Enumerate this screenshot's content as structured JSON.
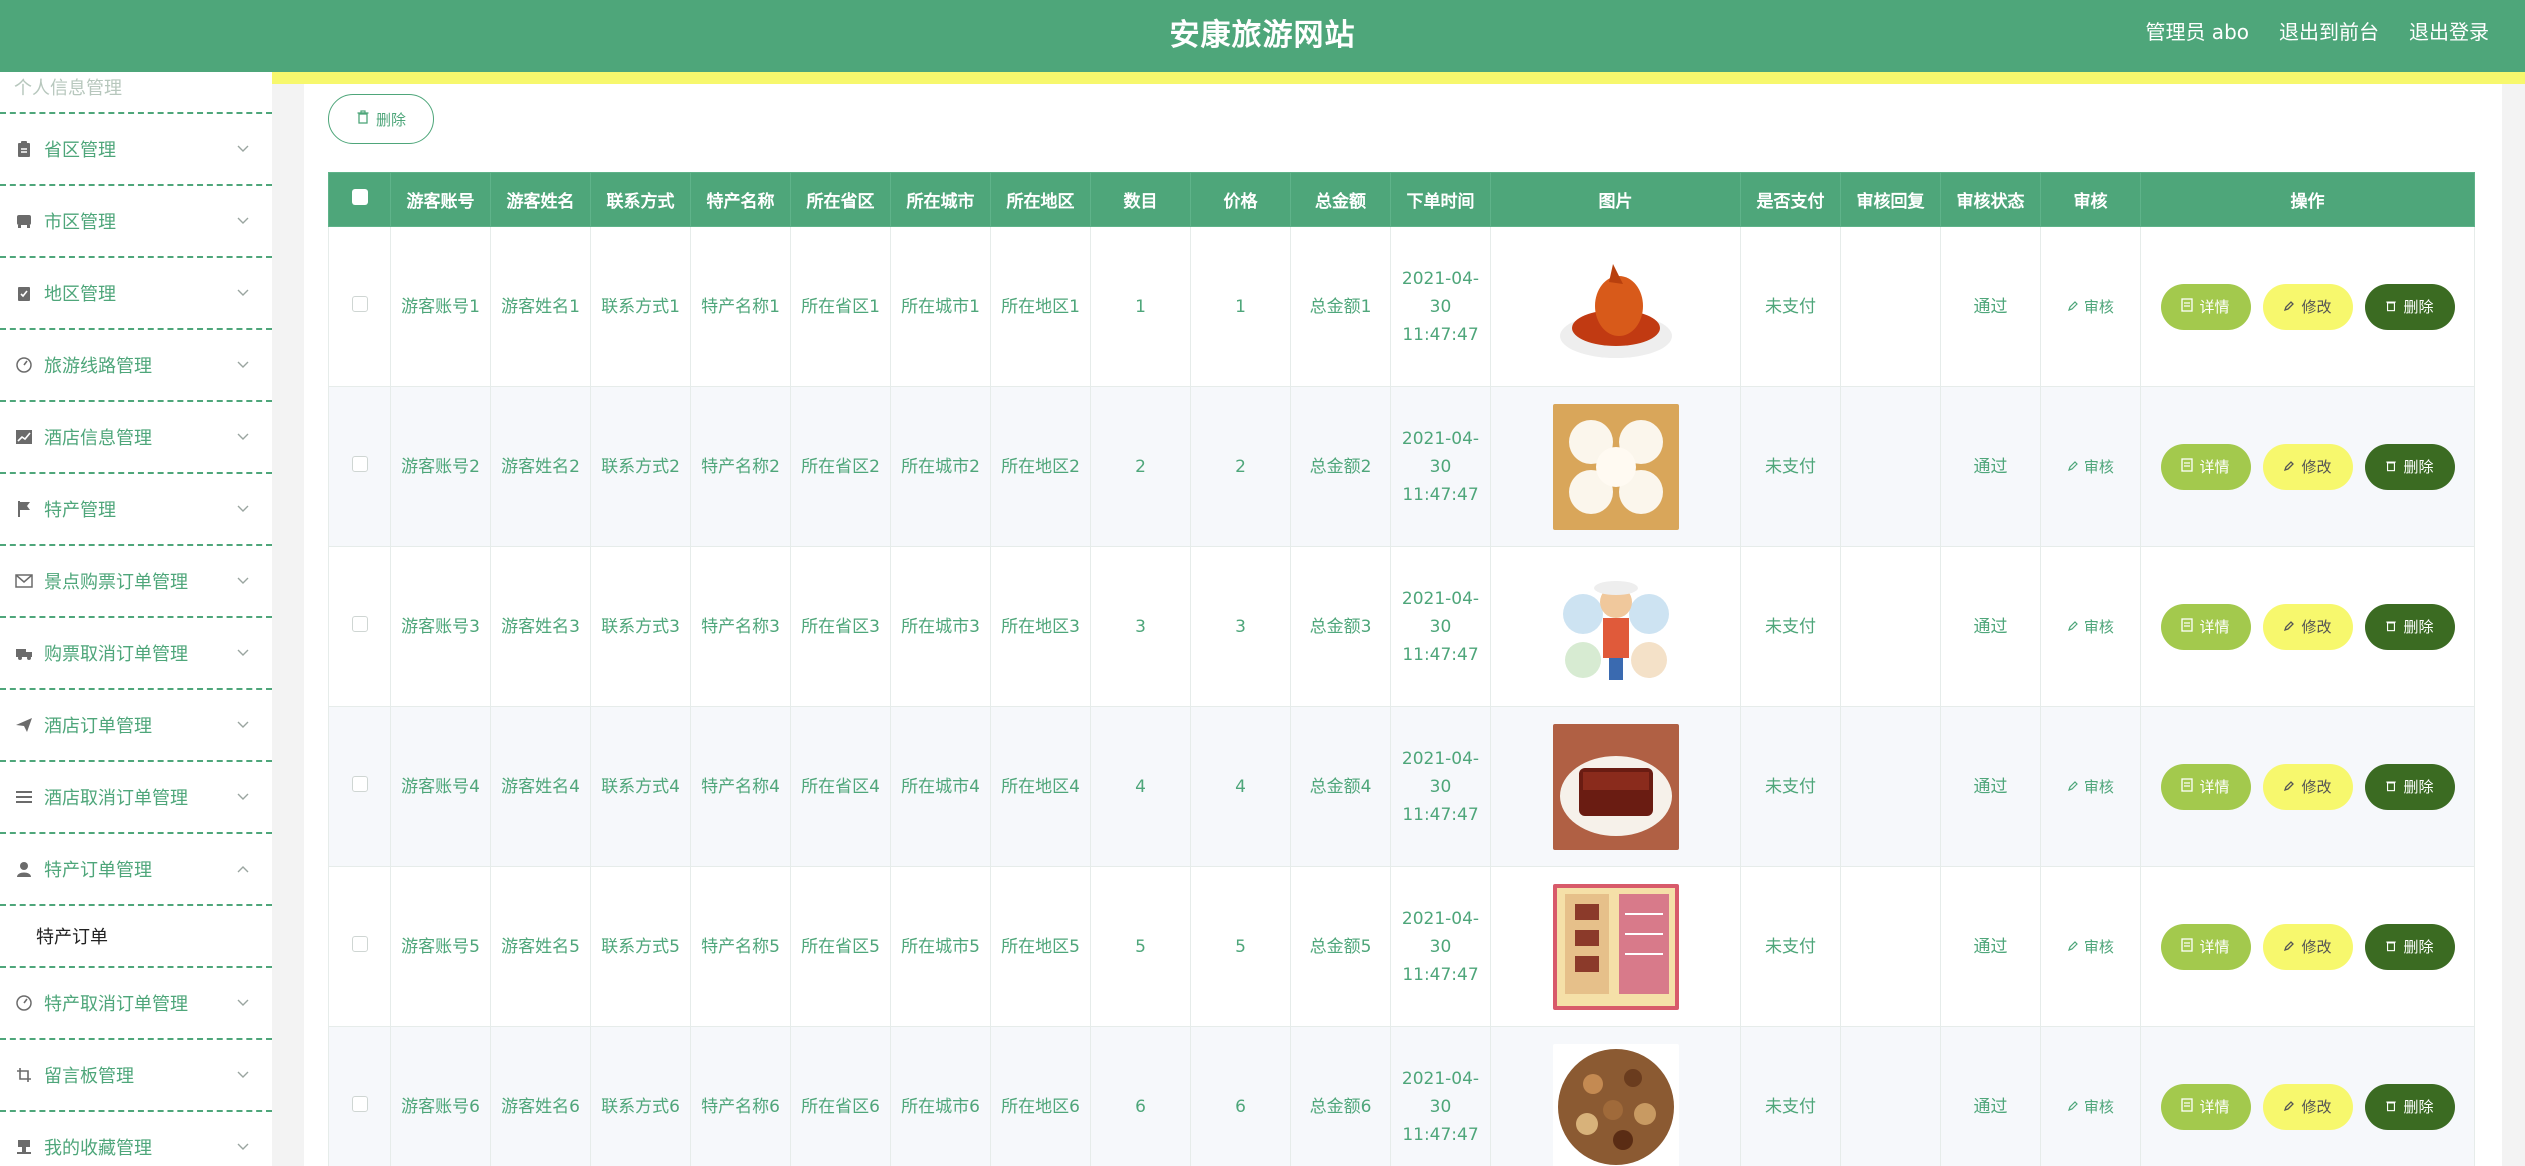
{
  "header": {
    "title": "安康旅游网站",
    "user": "管理员 abo",
    "back_front": "退出到前台",
    "logout": "退出登录"
  },
  "sidebar": {
    "top_faded": "个人信息管理",
    "items": [
      {
        "label": "省区管理",
        "icon": "clipboard-icon"
      },
      {
        "label": "市区管理",
        "icon": "bus-icon"
      },
      {
        "label": "地区管理",
        "icon": "checklist-icon"
      },
      {
        "label": "旅游线路管理",
        "icon": "compass-icon"
      },
      {
        "label": "酒店信息管理",
        "icon": "chart-icon"
      },
      {
        "label": "特产管理",
        "icon": "flag-icon"
      },
      {
        "label": "景点购票订单管理",
        "icon": "mail-icon"
      },
      {
        "label": "购票取消订单管理",
        "icon": "truck-icon"
      },
      {
        "label": "酒店订单管理",
        "icon": "send-icon"
      },
      {
        "label": "酒店取消订单管理",
        "icon": "list-icon"
      },
      {
        "label": "特产订单管理",
        "icon": "user-icon"
      }
    ],
    "sub_item": "特产订单",
    "items_after": [
      {
        "label": "特产取消订单管理",
        "icon": "compass-icon"
      },
      {
        "label": "留言板管理",
        "icon": "crop-icon"
      },
      {
        "label": "我的收藏管理",
        "icon": "stamp-icon"
      }
    ]
  },
  "toolbar": {
    "delete_label": "删除"
  },
  "table": {
    "headers": [
      "游客账号",
      "游客姓名",
      "联系方式",
      "特产名称",
      "所在省区",
      "所在城市",
      "所在地区",
      "数目",
      "价格",
      "总金额",
      "下单时间",
      "图片",
      "是否支付",
      "审核回复",
      "审核状态",
      "审核",
      "操作"
    ],
    "rows": [
      {
        "account": "游客账号1",
        "name": "游客姓名1",
        "phone": "联系方式1",
        "product": "特产名称1",
        "province": "所在省区1",
        "city": "所在城市1",
        "district": "所在地区1",
        "count": "1",
        "price": "1",
        "total": "总金额1",
        "time": "2021-04-30 11:47:47",
        "paid": "未支付",
        "reply": "",
        "status": "通过"
      },
      {
        "account": "游客账号2",
        "name": "游客姓名2",
        "phone": "联系方式2",
        "product": "特产名称2",
        "province": "所在省区2",
        "city": "所在城市2",
        "district": "所在地区2",
        "count": "2",
        "price": "2",
        "total": "总金额2",
        "time": "2021-04-30 11:47:47",
        "paid": "未支付",
        "reply": "",
        "status": "通过"
      },
      {
        "account": "游客账号3",
        "name": "游客姓名3",
        "phone": "联系方式3",
        "product": "特产名称3",
        "province": "所在省区3",
        "city": "所在城市3",
        "district": "所在地区3",
        "count": "3",
        "price": "3",
        "total": "总金额3",
        "time": "2021-04-30 11:47:47",
        "paid": "未支付",
        "reply": "",
        "status": "通过"
      },
      {
        "account": "游客账号4",
        "name": "游客姓名4",
        "phone": "联系方式4",
        "product": "特产名称4",
        "province": "所在省区4",
        "city": "所在城市4",
        "district": "所在地区4",
        "count": "4",
        "price": "4",
        "total": "总金额4",
        "time": "2021-04-30 11:47:47",
        "paid": "未支付",
        "reply": "",
        "status": "通过"
      },
      {
        "account": "游客账号5",
        "name": "游客姓名5",
        "phone": "联系方式5",
        "product": "特产名称5",
        "province": "所在省区5",
        "city": "所在城市5",
        "district": "所在地区5",
        "count": "5",
        "price": "5",
        "total": "总金额5",
        "time": "2021-04-30 11:47:47",
        "paid": "未支付",
        "reply": "",
        "status": "通过"
      },
      {
        "account": "游客账号6",
        "name": "游客姓名6",
        "phone": "联系方式6",
        "product": "特产名称6",
        "province": "所在省区6",
        "city": "所在城市6",
        "district": "所在地区6",
        "count": "6",
        "price": "6",
        "total": "总金额6",
        "time": "2021-04-30 11:47:47",
        "paid": "未支付",
        "reply": "",
        "status": "通过"
      }
    ],
    "audit_label": "审核",
    "detail_label": "详情",
    "edit_label": "修改",
    "delete_label": "删除"
  },
  "colors": {
    "primary": "#4ea67a",
    "accent_yellow": "#f7f86d",
    "detail_green": "#a3c94d",
    "delete_dark": "#3b6b22"
  }
}
